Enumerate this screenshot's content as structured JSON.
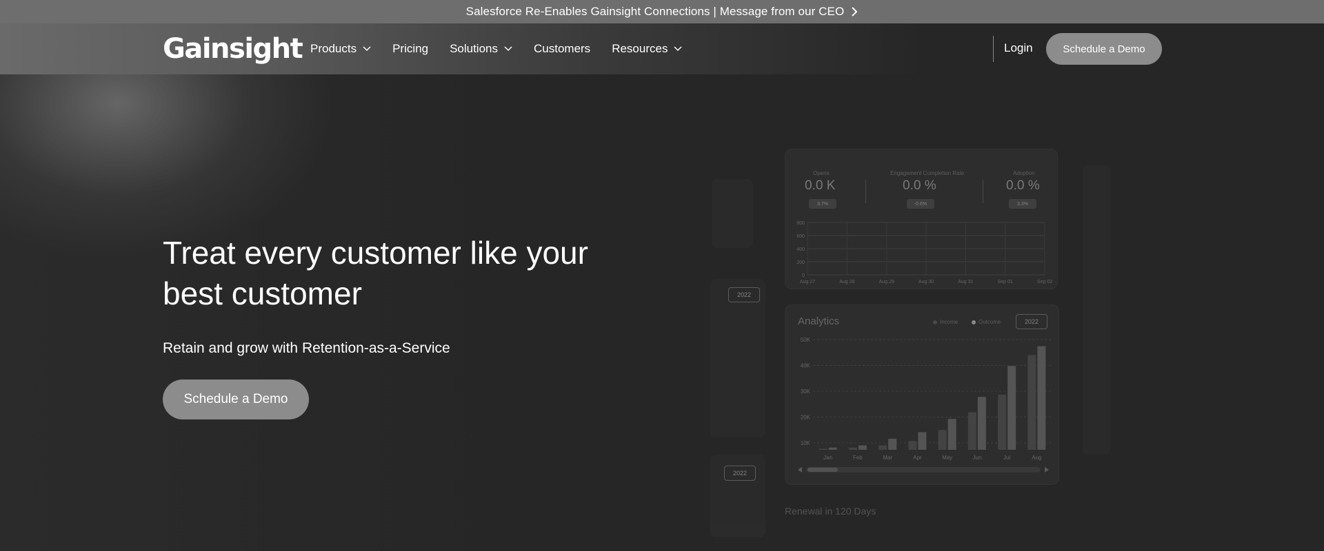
{
  "announcement": {
    "text": "Salesforce Re-Enables Gainsight Connections | Message from our CEO",
    "icon": "chevron-right-icon"
  },
  "header": {
    "logo": "Gainsight",
    "nav": [
      {
        "label": "Products",
        "dropdown": true
      },
      {
        "label": "Pricing",
        "dropdown": false
      },
      {
        "label": "Solutions",
        "dropdown": true
      },
      {
        "label": "Customers",
        "dropdown": false
      },
      {
        "label": "Resources",
        "dropdown": true
      }
    ],
    "login": "Login",
    "cta": "Schedule a Demo"
  },
  "hero": {
    "title": "Treat every customer like your best customer",
    "subtitle": "Retain and grow with Retention-as-a-Service",
    "cta": "Schedule a Demo"
  },
  "dashboard": {
    "kpis": [
      {
        "label": "Opens",
        "value": "0.0 K",
        "change": "3.7%",
        "dir": "up"
      },
      {
        "label": "Engagement Completion Rate",
        "value": "0.0 %",
        "change": "-0.6%",
        "dir": "down"
      },
      {
        "label": "Adoption",
        "value": "0.0 %",
        "change": "3.3%",
        "dir": "up"
      }
    ],
    "line_chart": {
      "y_ticks": [
        "800",
        "600",
        "400",
        "200",
        "0"
      ],
      "x_ticks": [
        "Aug 27",
        "Aug 28",
        "Aug 29",
        "Aug 30",
        "Aug 31",
        "Sep 01",
        "Sep 02"
      ]
    },
    "analytics": {
      "title": "Analytics",
      "legend": [
        "Income",
        "Outcome"
      ],
      "year": "2022",
      "y_ticks": [
        "50K",
        "40K",
        "30K",
        "20K",
        "10K"
      ],
      "months": [
        "Jan",
        "Feb",
        "Mar",
        "Apr",
        "May",
        "Jun",
        "Jul",
        "Aug"
      ],
      "income": [
        0.5,
        1,
        2,
        4,
        9,
        17,
        25,
        43
      ],
      "outcome": [
        1,
        2,
        5,
        8,
        14,
        24,
        38,
        47
      ],
      "ymax": 50
    },
    "side_year_1": "2022",
    "side_year_2": "2022",
    "renewal": "Renewal in 120 Days"
  },
  "colors": {
    "background": "#262626",
    "button": "#8c8c8c",
    "announcement": "#6e6e6e"
  }
}
